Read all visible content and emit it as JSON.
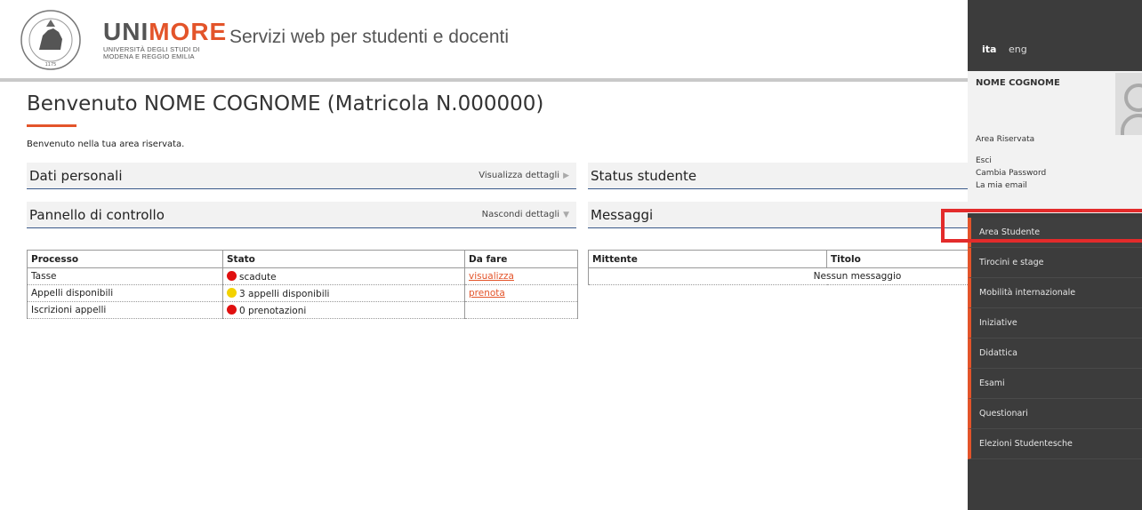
{
  "header": {
    "brand_prefix": "UNI",
    "brand_accent": "MORE",
    "brand_sub_line1": "UNIVERSITÀ DEGLI STUDI DI",
    "brand_sub_line2": "MODENA E REGGIO EMILIA",
    "title": "Servizi web per studenti e docenti",
    "seal_icon": "university-seal-icon"
  },
  "main": {
    "welcome_title": "Benvenuto NOME COGNOME (Matricola N.000000)",
    "welcome_text": "Benvenuto nella tua area riservata.",
    "sections": {
      "dati_personali": {
        "title": "Dati personali",
        "link": "Visualizza dettagli"
      },
      "pannello": {
        "title": "Pannello di controllo",
        "link": "Nascondi dettagli"
      },
      "status": {
        "title": "Status studente"
      },
      "messaggi": {
        "title": "Messaggi"
      }
    },
    "control_table": {
      "headers": [
        "Processo",
        "Stato",
        "Da fare"
      ],
      "rows": [
        {
          "processo": "Tasse",
          "stato": "scadute",
          "stato_color": "#e01010",
          "da_fare": "visualizza"
        },
        {
          "processo": "Appelli disponibili",
          "stato": "3 appelli disponibili",
          "stato_color": "#f3d200",
          "da_fare": "prenota"
        },
        {
          "processo": "Iscrizioni appelli",
          "stato": "0 prenotazioni",
          "stato_color": "#e01010",
          "da_fare": ""
        }
      ]
    },
    "messages_table": {
      "headers": [
        "Mittente",
        "Titolo"
      ],
      "empty": "Nessun messaggio"
    }
  },
  "sidebar": {
    "lang_active": "ita",
    "lang_other": "eng",
    "user_name": "NOME COGNOME",
    "user_links": [
      "Area Riservata",
      "Esci",
      "Cambia Password",
      "La mia email"
    ],
    "menu": [
      "Area Studente",
      "Tirocini e stage",
      "Mobilità internazionale",
      "Iniziative",
      "Didattica",
      "Esami",
      "Questionari",
      "Elezioni Studentesche"
    ]
  },
  "colors": {
    "accent": "#e3542a",
    "sidebar_bg": "#3c3c3c",
    "highlight": "#e32b2b"
  }
}
